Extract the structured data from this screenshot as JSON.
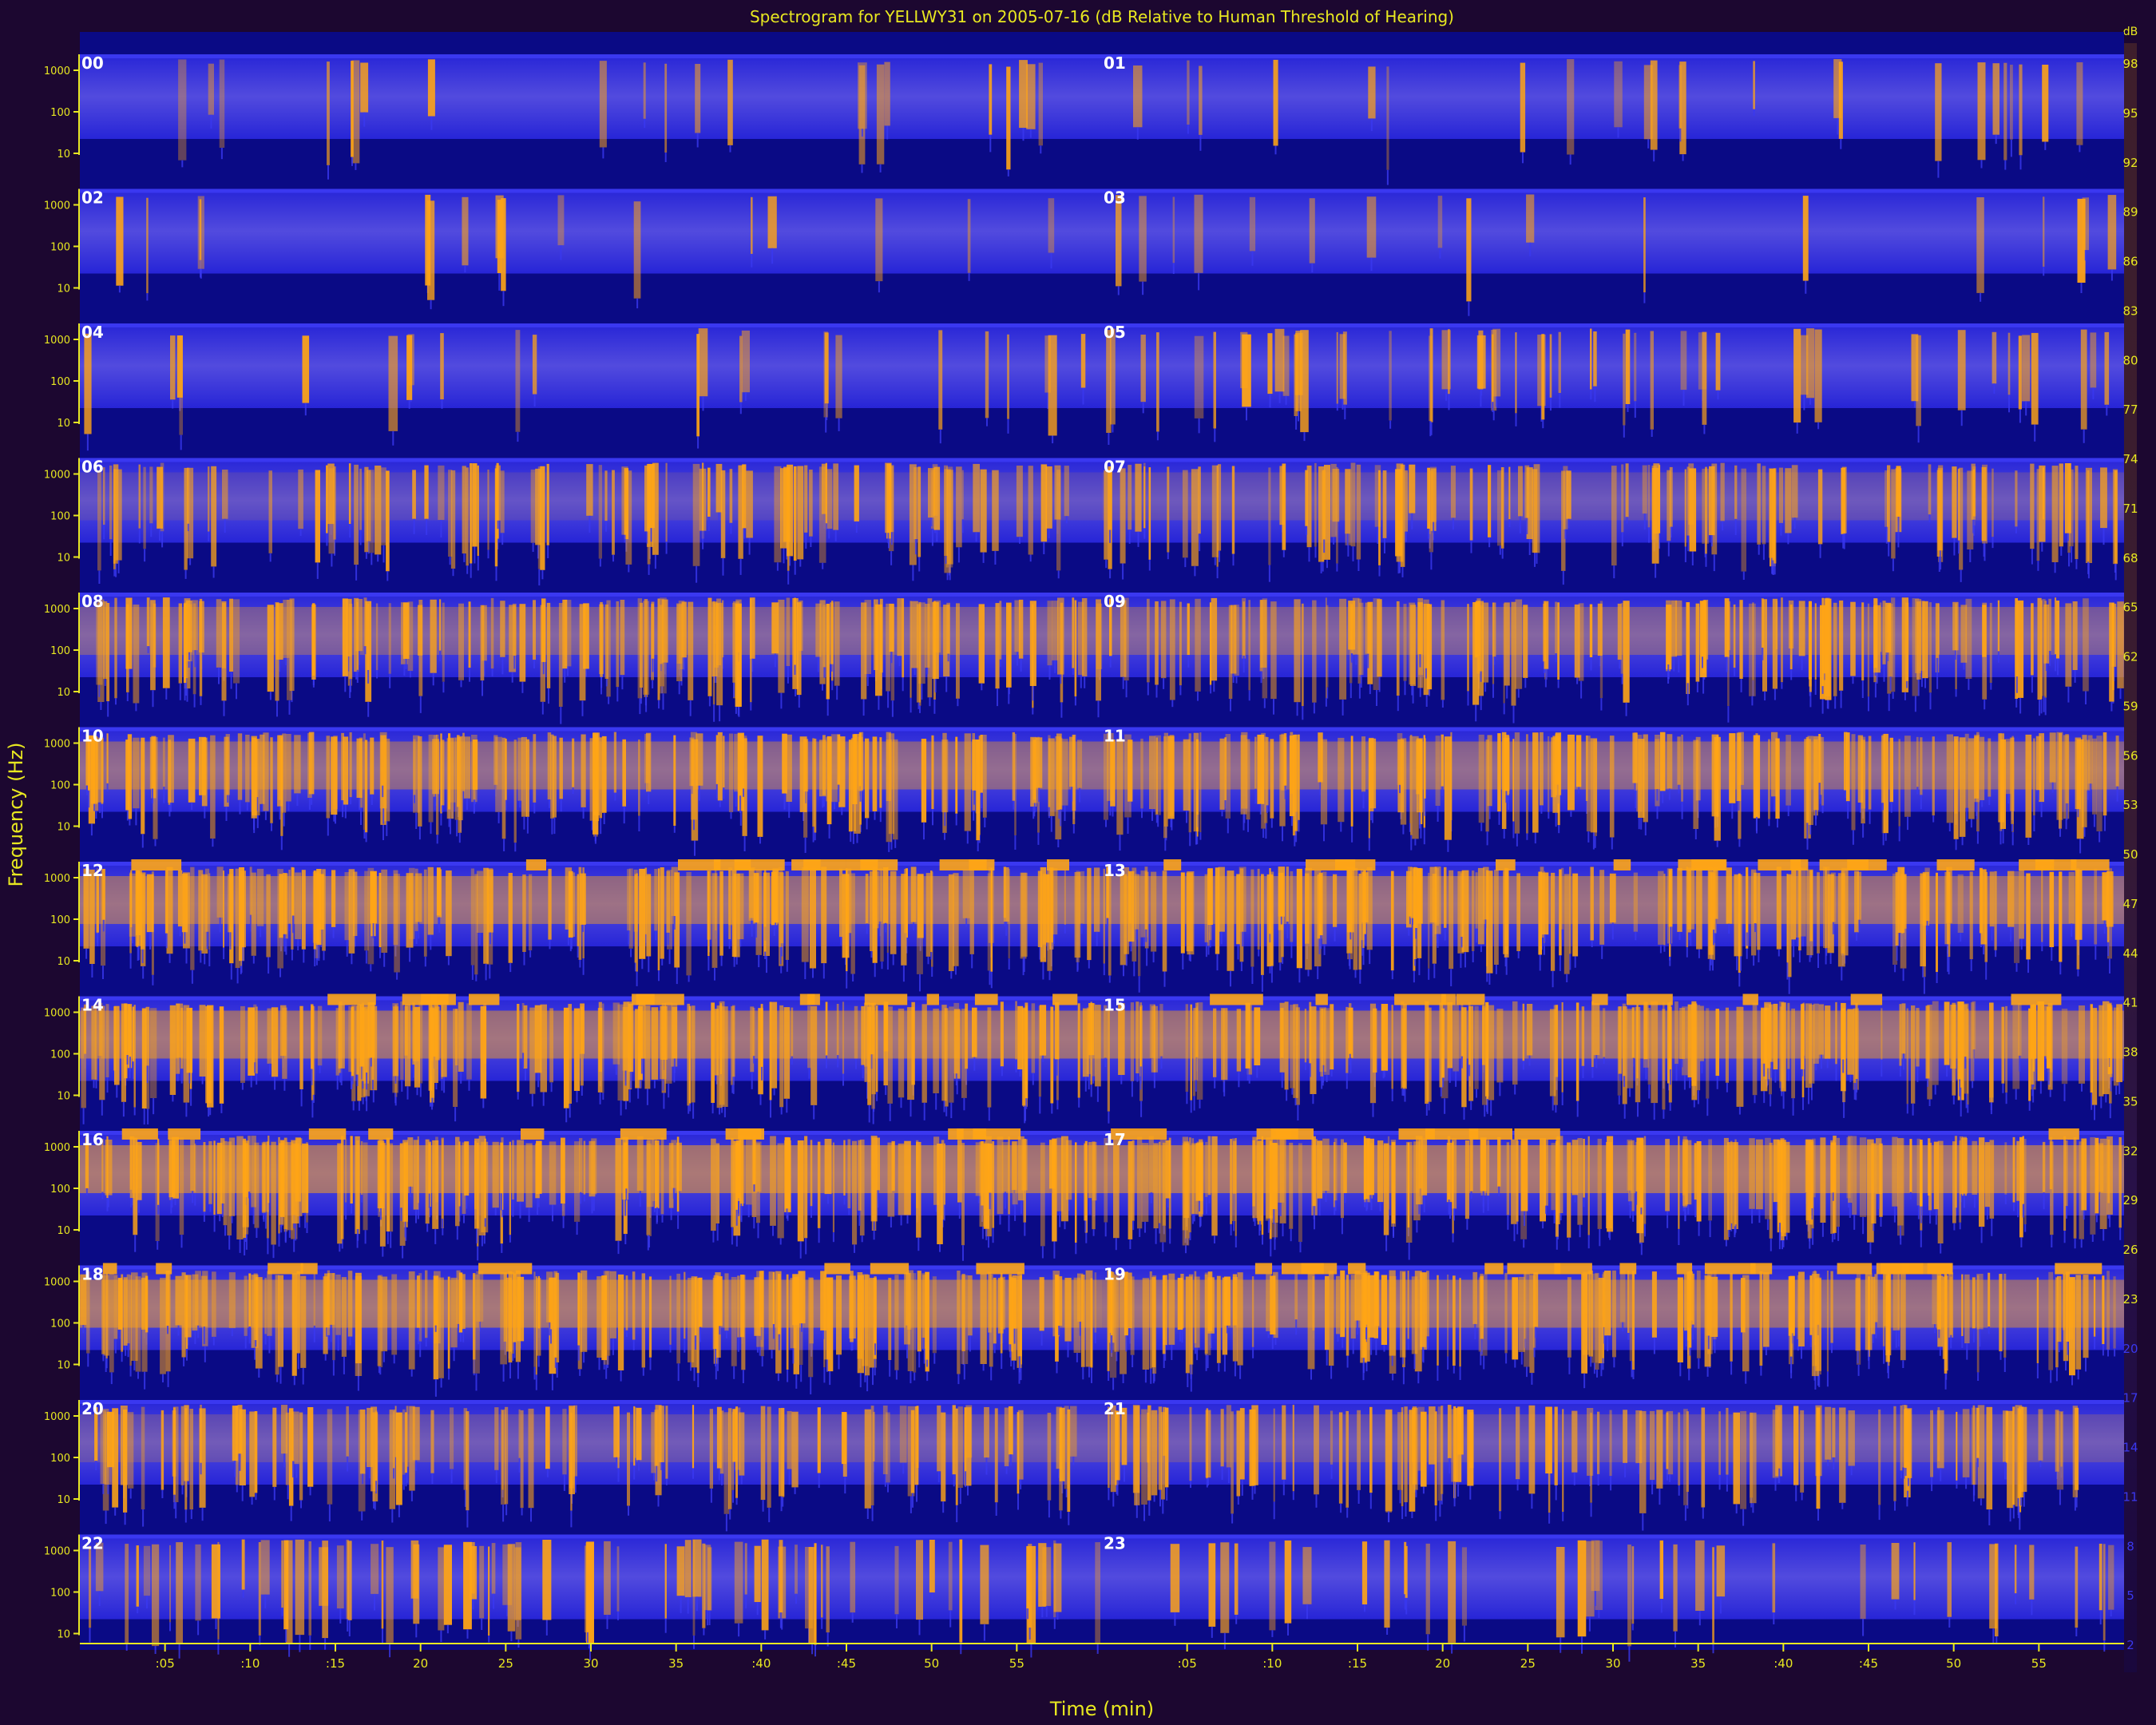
{
  "chart_data": {
    "type": "heatmap",
    "title": "Spectrogram for YELLWY31 on 2005-07-16 (dB Relative to Human Threshold of Hearing)",
    "xlabel": "Time (min)",
    "ylabel": "Frequency (Hz)",
    "y_tick_labels": [
      "1000",
      "100",
      "10"
    ],
    "x_tick_labels": [
      ":05",
      ":10",
      ":15",
      "20",
      "25",
      "30",
      "35",
      ":40",
      ":45",
      "50",
      "55"
    ],
    "colorbar_unit": "dB",
    "colorbar_ticks": [
      98,
      95,
      92,
      89,
      86,
      83,
      80,
      77,
      74,
      71,
      68,
      65,
      62,
      59,
      56,
      53,
      50,
      47,
      44,
      41,
      38,
      35,
      32,
      29,
      26,
      23,
      20,
      17,
      14,
      11,
      8,
      5,
      2
    ],
    "colorbar_range": [
      0,
      100
    ],
    "panels": [
      {
        "label": "00",
        "activity": 0.15,
        "bar_density": 0.05
      },
      {
        "label": "01",
        "activity": 0.18,
        "bar_density": 0.06
      },
      {
        "label": "02",
        "activity": 0.12,
        "bar_density": 0.03
      },
      {
        "label": "03",
        "activity": 0.12,
        "bar_density": 0.03
      },
      {
        "label": "04",
        "activity": 0.18,
        "bar_density": 0.06
      },
      {
        "label": "05",
        "activity": 0.3,
        "bar_density": 0.2
      },
      {
        "label": "06",
        "activity": 0.55,
        "bar_density": 0.45
      },
      {
        "label": "07",
        "activity": 0.6,
        "bar_density": 0.5
      },
      {
        "label": "08",
        "activity": 0.72,
        "bar_density": 0.65
      },
      {
        "label": "09",
        "activity": 0.72,
        "bar_density": 0.65
      },
      {
        "label": "10",
        "activity": 0.8,
        "bar_density": 0.7
      },
      {
        "label": "11",
        "activity": 0.8,
        "bar_density": 0.7
      },
      {
        "label": "12",
        "activity": 0.85,
        "bar_density": 0.72
      },
      {
        "label": "13",
        "activity": 0.85,
        "bar_density": 0.72
      },
      {
        "label": "14",
        "activity": 0.88,
        "bar_density": 0.75
      },
      {
        "label": "15",
        "activity": 0.88,
        "bar_density": 0.75
      },
      {
        "label": "16",
        "activity": 0.92,
        "bar_density": 0.78
      },
      {
        "label": "17",
        "activity": 0.92,
        "bar_density": 0.78
      },
      {
        "label": "18",
        "activity": 0.9,
        "bar_density": 0.76
      },
      {
        "label": "19",
        "activity": 0.85,
        "bar_density": 0.7
      },
      {
        "label": "20",
        "activity": 0.62,
        "bar_density": 0.5
      },
      {
        "label": "21",
        "activity": 0.62,
        "bar_density": 0.5
      },
      {
        "label": "22",
        "activity": 0.45,
        "bar_density": 0.3
      },
      {
        "label": "23",
        "activity": 0.28,
        "bar_density": 0.12
      }
    ],
    "colors": {
      "background": "#1c0730",
      "low": "#0a0a85",
      "mid": "#3a38f0",
      "high": "#ffa515",
      "axis": "#e8e820",
      "label": "#ffffff"
    }
  }
}
